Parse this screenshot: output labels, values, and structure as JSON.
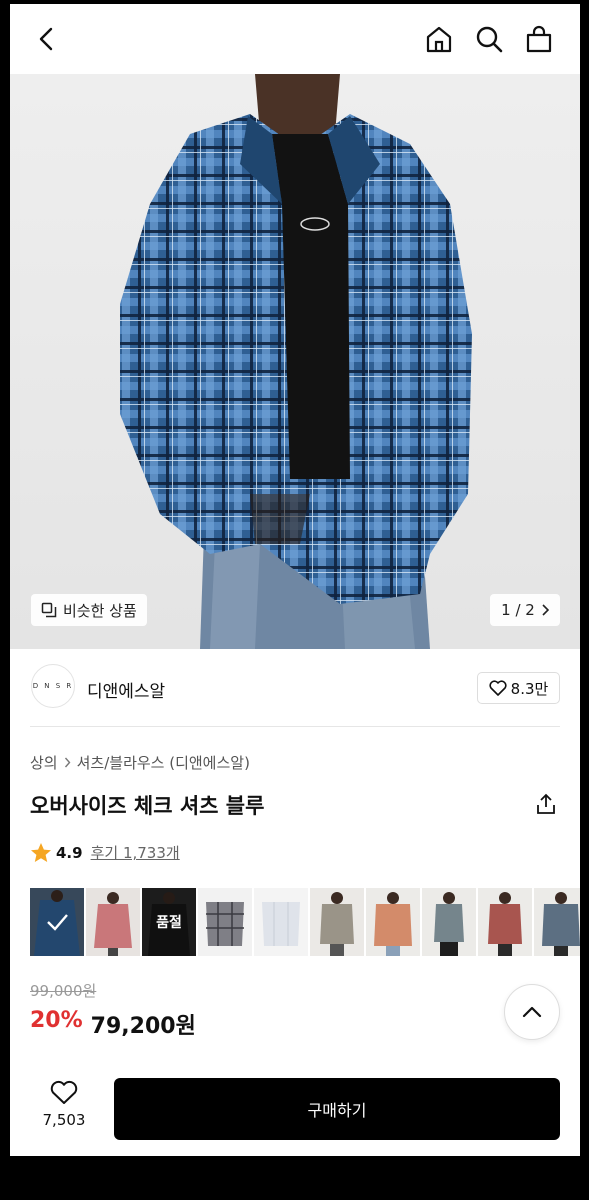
{
  "topbar": {
    "back_icon": "chevron-left-icon",
    "home_icon": "home-icon",
    "search_icon": "search-icon",
    "bag_icon": "shopping-bag-icon"
  },
  "hero": {
    "similar_label": "비슷한 상품",
    "similar_icon": "copy-icon",
    "page_indicator": "1 / 2"
  },
  "brand": {
    "logo_text": "D N S R",
    "name": "디앤에스알",
    "likes": "8.3만"
  },
  "product": {
    "breadcrumb": [
      "상의",
      "셔츠/블라우스 (디앤에스알)"
    ],
    "title": "오버사이즈 체크 셔츠 블루",
    "rating": "4.9",
    "review_label": "후기 1,733개"
  },
  "thumbnails": [
    {
      "label": "",
      "selected": true
    },
    {
      "label": "",
      "selected": false
    },
    {
      "label": "품절",
      "selected": false
    },
    {
      "label": "",
      "selected": false
    },
    {
      "label": "",
      "selected": false
    },
    {
      "label": "",
      "selected": false
    },
    {
      "label": "",
      "selected": false
    },
    {
      "label": "",
      "selected": false
    },
    {
      "label": "",
      "selected": false
    },
    {
      "label": "",
      "selected": false
    }
  ],
  "price": {
    "original": "99,000원",
    "discount": "20%",
    "sale": "79,200원"
  },
  "bottom": {
    "wish_count": "7,503",
    "buy_label": "구매하기"
  },
  "colors": {
    "accent_red": "#e03131",
    "star": "#f5a623",
    "buy_button": "#000000"
  }
}
